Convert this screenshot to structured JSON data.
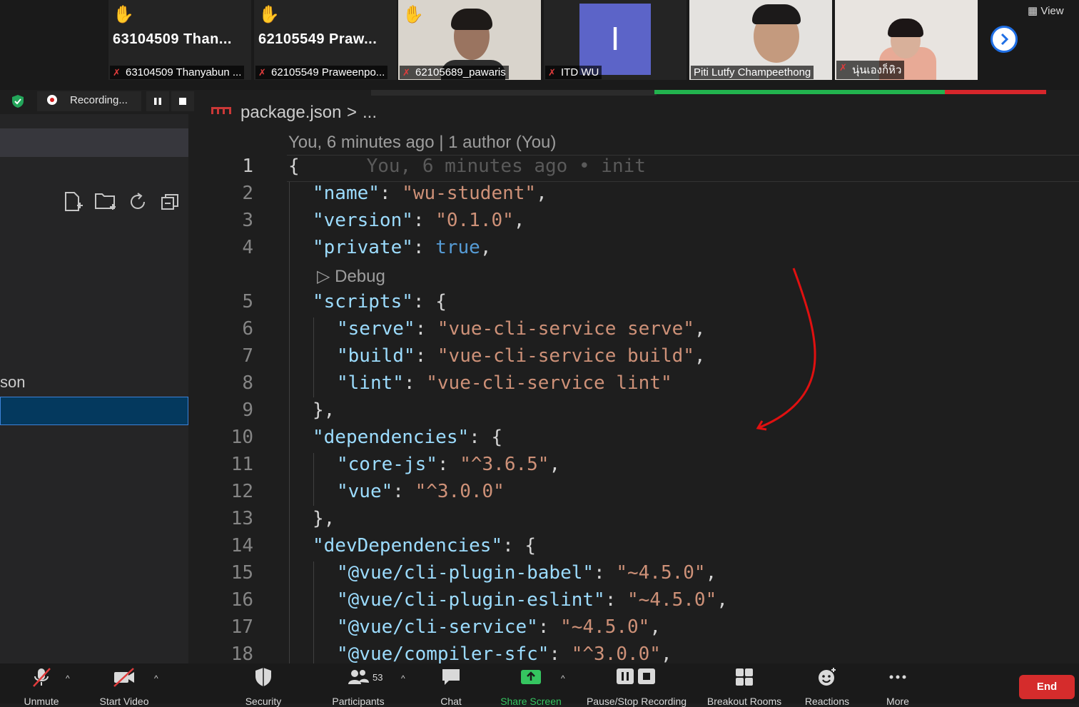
{
  "participants": [
    {
      "big_name": "63104509  Than...",
      "caption": "63104509 Thanyabun ...",
      "hand": true,
      "muted": true,
      "video": false
    },
    {
      "big_name": "62105549  Praw...",
      "caption": "62105549 Praweenpo...",
      "hand": true,
      "muted": true,
      "video": false
    },
    {
      "caption": "62105689_pawaris",
      "hand": true,
      "muted": true,
      "video": true
    },
    {
      "avatar_letter": "I",
      "caption": "ITD WU",
      "muted": true,
      "video": false
    },
    {
      "caption": "Piti Lutfy Champeethong",
      "muted": false,
      "video": true,
      "active_speaker": true
    },
    {
      "caption": "นุ่นเองก็หิว",
      "muted": true,
      "video": true
    }
  ],
  "view_label": "View",
  "recording": {
    "label": "Recording..."
  },
  "sidebar": {
    "partial_filename": "son"
  },
  "editor": {
    "breadcrumb_file": "package.json",
    "breadcrumb_sep": ">",
    "breadcrumb_more": "...",
    "blame": "You, 6 minutes ago | 1 author (You)",
    "inline_blame": "You, 6 minutes ago • init",
    "codelens_debug": "Debug",
    "line_numbers": [
      "1",
      "2",
      "3",
      "4",
      "5",
      "6",
      "7",
      "8",
      "9",
      "10",
      "11",
      "12",
      "13",
      "14",
      "15",
      "16",
      "17",
      "18"
    ],
    "code": {
      "l1": "{",
      "name_k": "\"name\"",
      "name_v": "\"wu-student\"",
      "version_k": "\"version\"",
      "version_v": "\"0.1.0\"",
      "private_k": "\"private\"",
      "private_v": "true",
      "scripts_k": "\"scripts\"",
      "serve_k": "\"serve\"",
      "serve_v": "\"vue-cli-service serve\"",
      "build_k": "\"build\"",
      "build_v": "\"vue-cli-service build\"",
      "lint_k": "\"lint\"",
      "lint_v": "\"vue-cli-service lint\"",
      "close_comma": "},",
      "deps_k": "\"dependencies\"",
      "corejs_k": "\"core-js\"",
      "corejs_v": "\"^3.6.5\"",
      "vue_k": "\"vue\"",
      "vue_v": "\"^3.0.0\"",
      "devdeps_k": "\"devDependencies\"",
      "babel_k": "\"@vue/cli-plugin-babel\"",
      "babel_v": "\"~4.5.0\"",
      "eslint_k": "\"@vue/cli-plugin-eslint\"",
      "eslint_v": "\"~4.5.0\"",
      "service_k": "\"@vue/cli-service\"",
      "service_v": "\"~4.5.0\"",
      "sfc_k": "\"@vue/compiler-sfc\"",
      "sfc_v": "\"^3.0.0\""
    }
  },
  "toolbar": {
    "unmute": "Unmute",
    "start_video": "Start Video",
    "security": "Security",
    "participants": "Participants",
    "participants_count": "53",
    "chat": "Chat",
    "share_screen": "Share Screen",
    "pause_stop": "Pause/Stop Recording",
    "breakout": "Breakout Rooms",
    "reactions": "Reactions",
    "more": "More",
    "end": "End"
  },
  "colors": {
    "accent_green": "#35c560",
    "end_red": "#d52c2c",
    "selection_blue": "#04395e"
  }
}
